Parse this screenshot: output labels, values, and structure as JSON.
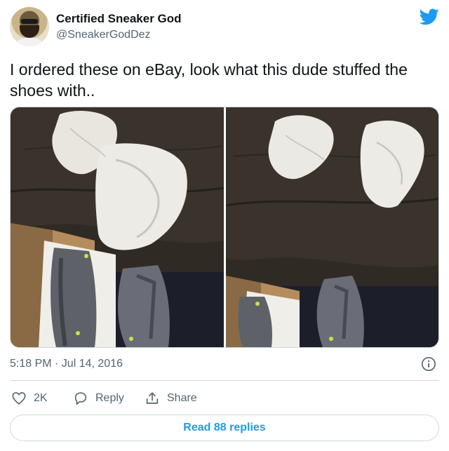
{
  "author": {
    "name": "Certified Sneaker God",
    "handle": "@SneakerGodDez"
  },
  "tweet": {
    "text": "I ordered these on eBay, look what this dude stuffed the shoes with..",
    "timestamp": "5:18 PM · Jul 14, 2016"
  },
  "media": {
    "photo_count": 2
  },
  "actions": {
    "likes": "2K",
    "reply_label": "Reply",
    "share_label": "Share"
  },
  "replies_button": "Read 88 replies",
  "colors": {
    "brand_blue": "#1d9bf0",
    "secondary_text": "#536471",
    "border": "#cfd9de"
  },
  "icons": [
    "twitter-bird-icon",
    "info-icon",
    "heart-icon",
    "reply-icon",
    "share-icon"
  ]
}
